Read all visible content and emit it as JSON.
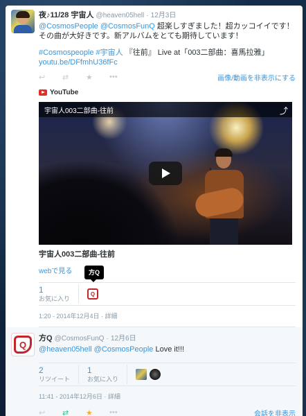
{
  "tweet1": {
    "name": "夜♪11/28 宇宙人",
    "screen_name": "@heaven05hell",
    "separator": "·",
    "time": "12月3日",
    "mentions": "@CosmosPeople @CosmosFunQ",
    "text_line1": "超楽しすぎました！超カッコイイです！",
    "text_line2": "その曲が大好きです。新アルバムをとても期待しています！",
    "hashtags": "#Cosmospeople #宇宙人",
    "hashtag_text": "『往前』 Live at「003二部曲：喜馬拉雅」",
    "short_link": "youtu.be/DFfmhU36fFc",
    "hide_media": "画像/動画を非表示にする",
    "card_source": "YouTube",
    "video_title_overlay": "宇宙人003二部曲-往前",
    "video_title": "宇宙人003二部曲-往前",
    "web_view_link": "webで見る",
    "tooltip": "方Q",
    "favorites_count": "1",
    "favorites_label": "お気に入り",
    "timestamp": "1:20 - 2014年12月4日 · 詳細"
  },
  "tweet2": {
    "name": "方Q",
    "screen_name": "@CosmosFunQ",
    "separator": "·",
    "time": "12月6日",
    "mentions": "@heaven05hell @CosmosPeople",
    "text": "Love it!!!",
    "retweets_count": "2",
    "retweets_label": "リツイート",
    "favorites_count": "1",
    "favorites_label": "お気に入り",
    "timestamp": "11:41 - 2014年12月6日 · 詳細",
    "hide_conversation": "会話を非表示"
  },
  "icons": {
    "reply": "↩",
    "retweet": "⇄",
    "favorite": "★",
    "more": "•••",
    "share": "⤴"
  },
  "colors": {
    "link": "#3b94d9",
    "retweet_active": "#19cf86",
    "favorite_active": "#ffac33",
    "youtube_red": "#e52d27"
  }
}
